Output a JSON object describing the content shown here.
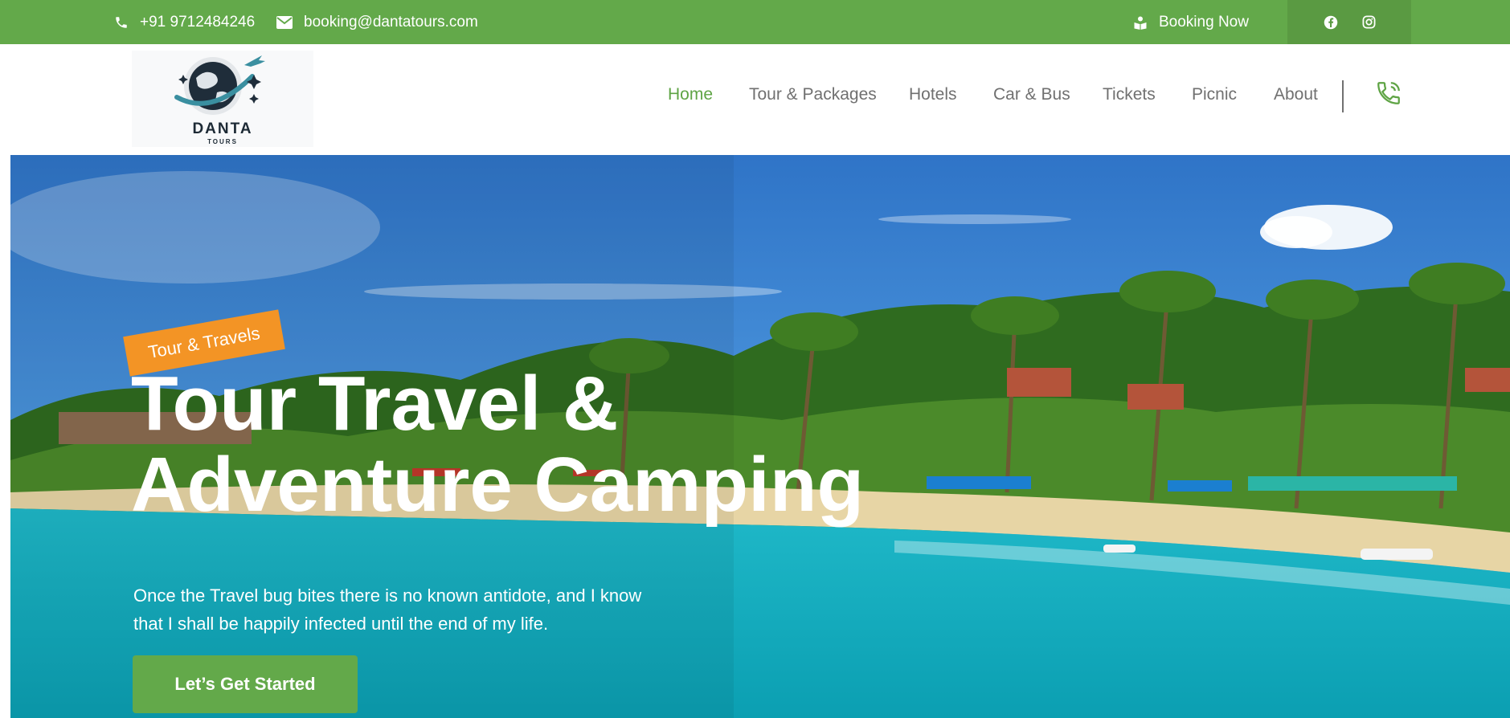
{
  "topbar": {
    "phone": "+91 9712484246",
    "email": "booking@dantatours.com",
    "booking_label": "Booking Now",
    "icons": {
      "phone": "phone-icon",
      "email": "envelope-icon",
      "booking": "booking-icon",
      "facebook": "facebook-icon",
      "instagram": "instagram-icon"
    }
  },
  "header": {
    "logo": {
      "name": "DANTA",
      "tagline": "TOURS"
    },
    "nav": [
      {
        "label": "Home",
        "active": true
      },
      {
        "label": "Tour & Packages",
        "active": false
      },
      {
        "label": "Hotels",
        "active": false
      },
      {
        "label": "Car & Bus",
        "active": false
      },
      {
        "label": "Tickets",
        "active": false
      },
      {
        "label": "Picnic",
        "active": false
      },
      {
        "label": "About",
        "active": false
      }
    ],
    "call_icon": "phone-call-icon"
  },
  "hero": {
    "badge": "Tour & Travels",
    "title_lines": [
      "Tour Travel &",
      "Adventure Camping"
    ],
    "description_lines": [
      "Once the Travel bug bites there is no known antidote, and I know",
      "that I shall be happily infected until the end of my life."
    ],
    "cta_label": "Let’s Get Started"
  },
  "colors": {
    "brand_green": "#63a94a",
    "nav_active": "#5fa445",
    "nav_text": "#707070",
    "badge_orange": "#f39425"
  }
}
